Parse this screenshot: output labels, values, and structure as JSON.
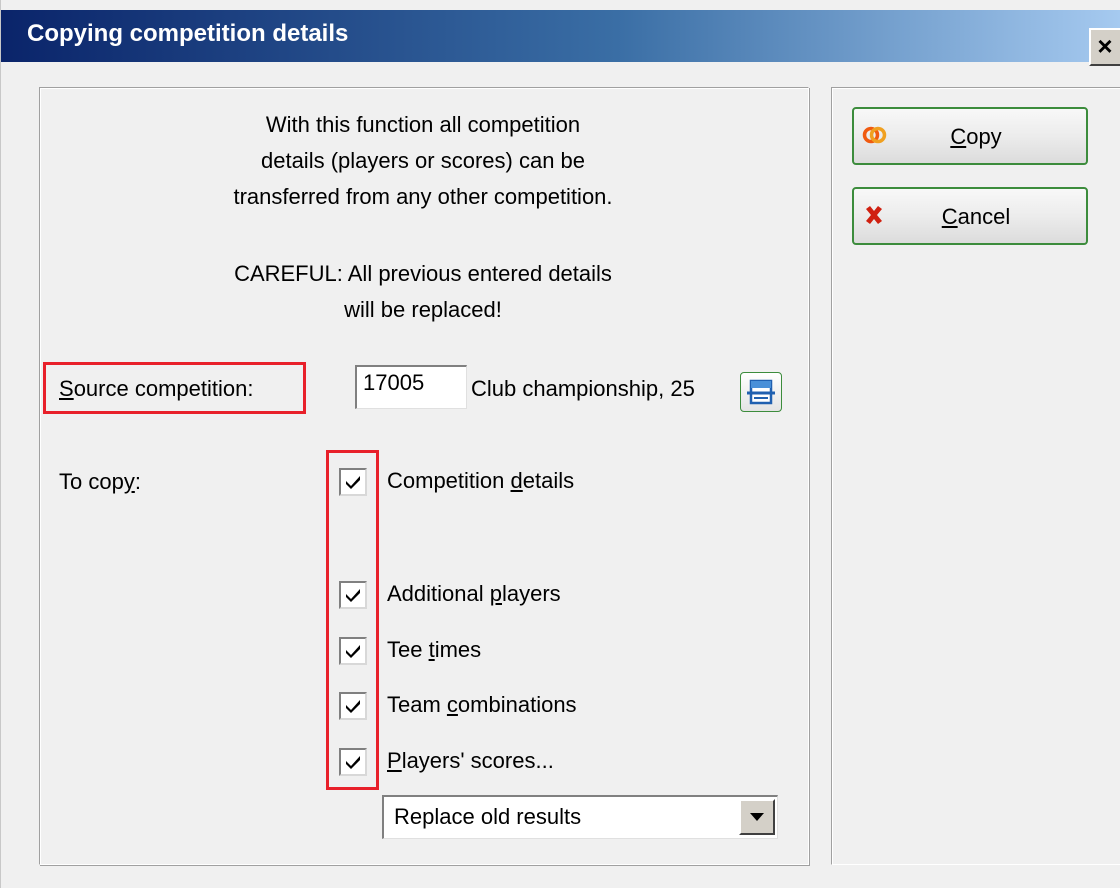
{
  "window": {
    "title": "Copying competition details",
    "close_label": "×"
  },
  "intro": {
    "line1": "With this function all competition",
    "line2": "details (players or scores) can be",
    "line3": "transferred from any other competition.",
    "careful1": "CAREFUL: All previous entered details",
    "careful2": "will be replaced!"
  },
  "source": {
    "label_hotkey": "S",
    "label_rest": "ource competition:",
    "value": "17005",
    "name": "Club championship, 25"
  },
  "to_copy": {
    "label_pre": "To cop",
    "label_hotkey": "y",
    "label_post": ":"
  },
  "checkboxes": [
    {
      "pre": "Competition ",
      "hotkey": "d",
      "post": "etails",
      "checked": true
    },
    {
      "pre": "Additional ",
      "hotkey": "p",
      "post": "layers",
      "checked": true
    },
    {
      "pre": "Tee ",
      "hotkey": "t",
      "post": "imes",
      "checked": true
    },
    {
      "pre": "Team ",
      "hotkey": "c",
      "post": "ombinations",
      "checked": true
    },
    {
      "pre": "",
      "hotkey": "P",
      "post": "layers' scores...",
      "checked": true
    }
  ],
  "results_mode": {
    "selected": "Replace old results"
  },
  "buttons": {
    "copy": {
      "hotkey": "C",
      "rest": "opy",
      "icon": "copy-rings-icon"
    },
    "cancel": {
      "hotkey": "C",
      "rest": "ancel",
      "icon": "cancel-x-icon"
    }
  },
  "colors": {
    "highlight": "#e8202a",
    "title_bar": "#0a246a",
    "button_border": "#3c8c3c"
  }
}
